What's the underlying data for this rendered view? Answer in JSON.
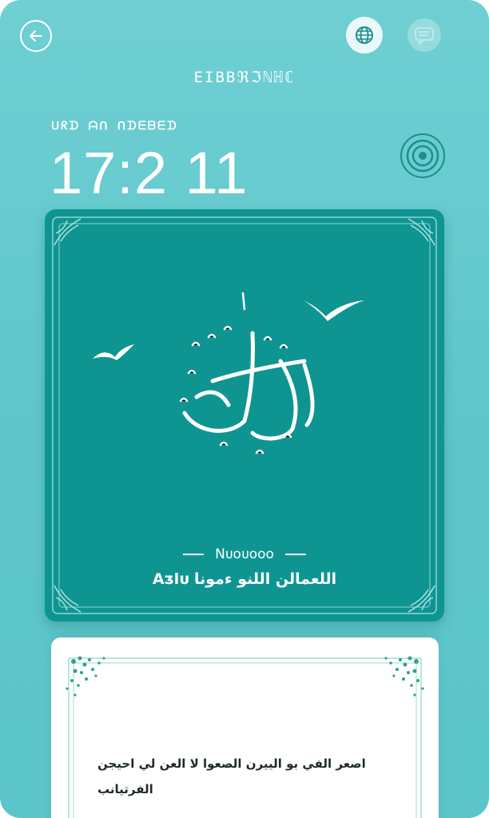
{
  "header": {
    "back_icon": "arrow-left-icon",
    "globe_icon": "globe-icon",
    "chat_icon": "chat-bubble-icon",
    "app_title": "ΕΙΒBℜℑℕℍℂ"
  },
  "clock": {
    "date_label": "ᑌᖇᗪ ᗩᑎ ᑎᗪᗴᗷᗴᗪ",
    "time": "17:2 11",
    "target_icon": "target-icon"
  },
  "hero": {
    "calligraphy": "رمضان",
    "subtitle": "Nᴜᴏᴜᴏᴏᴏ",
    "caption": "Aᴣlᴜ اللعمالن اللنو ءمونا"
  },
  "verse": {
    "line1": "اصعر الفي بو الييرن الصعوا لا العن لي احيجن",
    "line2": "الفرتيانب"
  },
  "colors": {
    "background": "#5ec6cb",
    "card_teal": "#0e9592",
    "card_white": "#ffffff",
    "ornament_green": "#1f9e86"
  }
}
